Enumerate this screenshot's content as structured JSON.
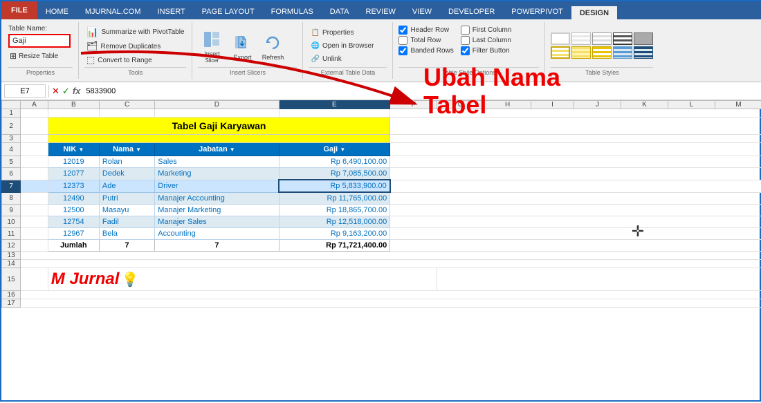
{
  "tabs": {
    "file": "FILE",
    "home": "HOME",
    "mjurnal": "MJURNAL.COM",
    "insert": "INSERT",
    "pageLayout": "PAGE LAYOUT",
    "formulas": "FORMULAS",
    "data": "DATA",
    "review": "REVIEW",
    "view": "VIEW",
    "developer": "DEVELOPER",
    "powerPivot": "POWERPIVOT",
    "design": "DESIGN"
  },
  "ribbon": {
    "properties": {
      "label": "Properties",
      "tableName": "Table Name:",
      "tableNameValue": "Gaji",
      "resizeTable": "Resize Table"
    },
    "tools": {
      "label": "Tools",
      "summarize": "Summarize with PivotTable",
      "removeDuplicates": "Remove Duplicates",
      "convertToRange": "Convert to Range"
    },
    "insert": {
      "label": "Insert",
      "insert": "Insert",
      "export": "Export",
      "refresh": "Refresh",
      "slicer": "Slicer"
    },
    "externalData": {
      "label": "External Table Data",
      "properties": "Properties",
      "openInBrowser": "Open in Browser",
      "unlink": "Unlink"
    },
    "styleOptions": {
      "label": "Table Style Options",
      "headerRow": "Header Row",
      "totalRow": "Total Row",
      "bandedRows": "Banded Rows",
      "firstColumn": "First Column",
      "lastColumn": "Last Column",
      "filterButton": "Filter Button"
    },
    "tableStyles": {
      "label": "Table Styles"
    }
  },
  "formulaBar": {
    "cellRef": "E7",
    "formula": "5833900"
  },
  "grid": {
    "columnHeaders": [
      "",
      "A",
      "B",
      "C",
      "D",
      "E",
      "F",
      "G",
      "H",
      "I",
      "J",
      "K",
      "L",
      "M"
    ],
    "rowHeaders": [
      "1",
      "2",
      "3",
      "4",
      "5",
      "6",
      "7",
      "8",
      "9",
      "10",
      "11",
      "12",
      "13",
      "14",
      "15",
      "16",
      "17"
    ],
    "title": "Tabel Gaji Karyawan",
    "tableHeaders": [
      "NIK",
      "Nama",
      "Jabatan",
      "Gaji"
    ],
    "rows": [
      {
        "nik": "12019",
        "nama": "Rolan",
        "jabatan": "Sales",
        "gaji": "Rp  6,490,100.00"
      },
      {
        "nik": "12077",
        "nama": "Dedek",
        "jabatan": "Marketing",
        "gaji": "Rp  7,085,500.00"
      },
      {
        "nik": "12373",
        "nama": "Ade",
        "jabatan": "Driver",
        "gaji": "Rp  5,833,900.00"
      },
      {
        "nik": "12490",
        "nama": "Putri",
        "jabatan": "Manajer Accounting",
        "gaji": "Rp 11,765,000.00"
      },
      {
        "nik": "12500",
        "nama": "Masayu",
        "jabatan": "Manajer Marketing",
        "gaji": "Rp 18,865,700.00"
      },
      {
        "nik": "12754",
        "nama": "Fadil",
        "jabatan": "Manajer Sales",
        "gaji": "Rp 12,518,000.00"
      },
      {
        "nik": "12967",
        "nama": "Bela",
        "jabatan": "Accounting",
        "gaji": "Rp  9,163,200.00"
      }
    ],
    "totalRow": {
      "label": "Jumlah",
      "count1": "7",
      "count2": "7",
      "total": "Rp 71,721,400.00"
    }
  },
  "annotation": {
    "title1": "Ubah Nama",
    "title2": "Tabel"
  },
  "mjurnal": {
    "text": "M Jurnal"
  }
}
